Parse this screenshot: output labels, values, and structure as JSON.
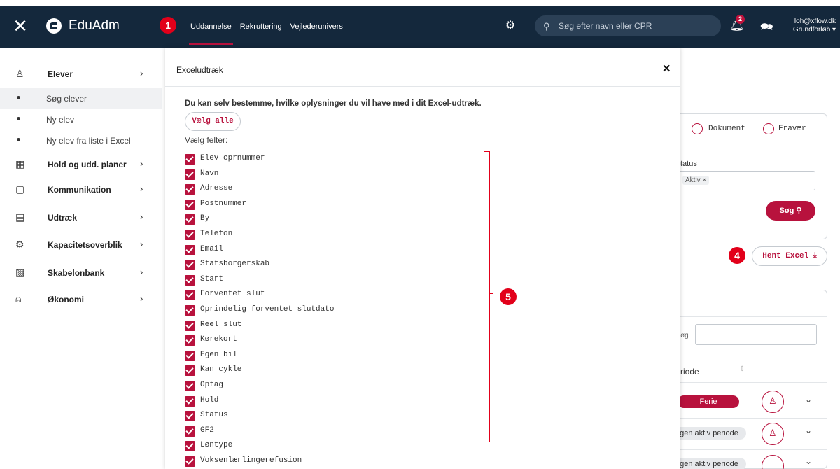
{
  "app": {
    "brand": "EduAdm"
  },
  "topbar": {
    "nav": [
      "Uddannelse",
      "Rekruttering",
      "Vejlederunivers"
    ],
    "search_placeholder": "Søg efter navn eller CPR",
    "notifications_count": "2",
    "user_email": "loh@xflow.dk",
    "user_role": "Grundforløb ▾"
  },
  "callouts": {
    "one": "1",
    "four": "4",
    "five": "5"
  },
  "sidebar": {
    "items": [
      {
        "label": "Elever",
        "icon": "person-icon"
      },
      {
        "label": "Hold og udd. planer",
        "icon": "calendar-icon"
      },
      {
        "label": "Kommunikation",
        "icon": "chat-icon"
      },
      {
        "label": "Udtræk",
        "icon": "report-icon"
      },
      {
        "label": "Kapacitetsoverblik",
        "icon": "capacity-icon"
      },
      {
        "label": "Skabelonbank",
        "icon": "template-icon"
      },
      {
        "label": "Økonomi",
        "icon": "lock-icon"
      }
    ],
    "sub_items": [
      "Søg elever",
      "Ny elev",
      "Ny elev fra liste i Excel"
    ]
  },
  "background": {
    "radio_document": "Dokument",
    "radio_absence": "Fravær",
    "status_label": "tatus",
    "status_tag": "Aktiv ×",
    "search_button": "Søg",
    "excel_button": "Hent Excel",
    "filter_label": "øg",
    "period_header": "riode",
    "row1_tag": "Ferie",
    "row2_tag": "gen aktiv periode",
    "row3_tag": "gen aktiv periode",
    "colors": {
      "accent": "#b8123d",
      "topbar": "#14283c",
      "callout": "#e2001a"
    }
  },
  "modal": {
    "title": "Exceludtræk",
    "intro": "Du kan selv bestemme, hvilke oplysninger du vil have med i dit Excel-udtræk.",
    "select_all": "Vælg alle",
    "choose_fields": "Vælg felter:",
    "fields": [
      "Elev cprnummer",
      "Navn",
      "Adresse",
      "Postnummer",
      "By",
      "Telefon",
      "Email",
      "Statsborgerskab",
      "Start",
      "Forventet slut",
      "Oprindelig forventet slutdato",
      "Reel slut",
      "Kørekort",
      "Egen bil",
      "Kan cykle",
      "Optag",
      "Hold",
      "Status",
      "GF2",
      "Løntype",
      "Voksenlærlingerefusion"
    ]
  }
}
